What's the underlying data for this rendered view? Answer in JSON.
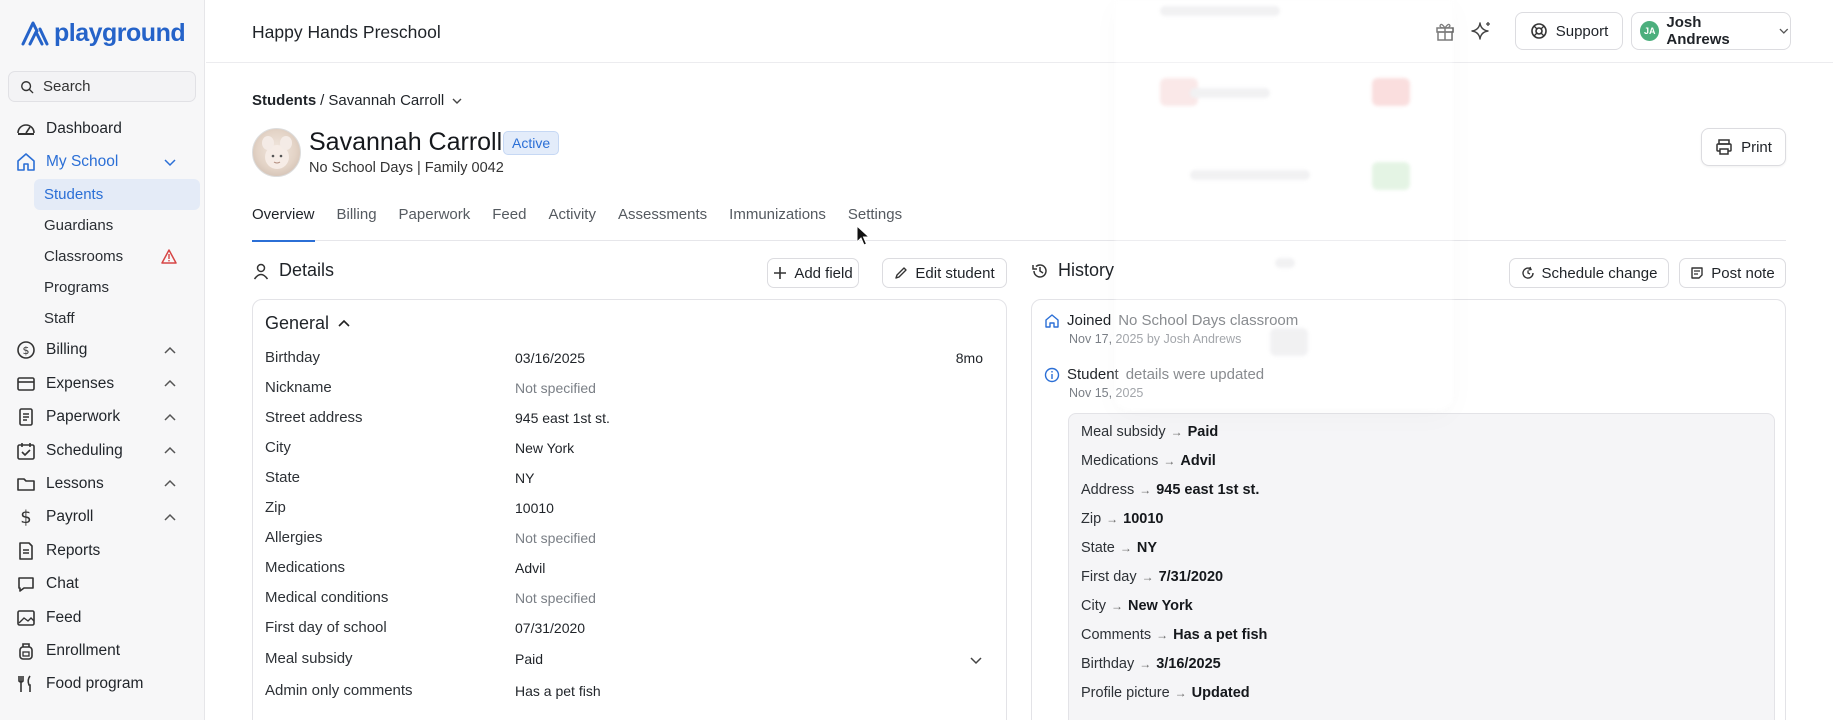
{
  "app": {
    "logo_text": "playground",
    "search_label": "Search"
  },
  "sidebar": {
    "items": [
      {
        "label": "Dashboard",
        "icon": "dashboard-icon"
      },
      {
        "label": "My School",
        "icon": "home-icon",
        "expanded": true
      },
      {
        "label": "Billing",
        "icon": "dollar-circle-icon"
      },
      {
        "label": "Expenses",
        "icon": "card-icon"
      },
      {
        "label": "Paperwork",
        "icon": "paperwork-icon"
      },
      {
        "label": "Scheduling",
        "icon": "calendar-check-icon"
      },
      {
        "label": "Lessons",
        "icon": "folder-icon"
      },
      {
        "label": "Payroll",
        "icon": "dollar-icon"
      },
      {
        "label": "Reports",
        "icon": "report-icon"
      },
      {
        "label": "Chat",
        "icon": "chat-icon"
      },
      {
        "label": "Feed",
        "icon": "image-icon"
      },
      {
        "label": "Enrollment",
        "icon": "backpack-icon"
      },
      {
        "label": "Food program",
        "icon": "utensils-icon"
      }
    ],
    "my_school_sub": [
      {
        "label": "Students",
        "selected": true
      },
      {
        "label": "Guardians"
      },
      {
        "label": "Classrooms",
        "warning": true
      },
      {
        "label": "Programs"
      },
      {
        "label": "Staff"
      }
    ]
  },
  "topbar": {
    "school_name": "Happy Hands Preschool",
    "support_label": "Support",
    "user_name": "Josh Andrews",
    "user_initials": "JA"
  },
  "breadcrumb": {
    "parent": "Students",
    "separator": "/",
    "current": "Savannah Carroll"
  },
  "student": {
    "name": "Savannah Carroll",
    "status": "Active",
    "subtitle": "No School Days | Family 0042"
  },
  "print_label": "Print",
  "tabs": [
    "Overview",
    "Billing",
    "Paperwork",
    "Feed",
    "Activity",
    "Assessments",
    "Immunizations",
    "Settings"
  ],
  "details": {
    "title": "Details",
    "add_field_label": "Add field",
    "edit_student_label": "Edit student",
    "general_title": "General",
    "fields": [
      {
        "label": "Birthday",
        "value": "03/16/2025",
        "extra": "8mo"
      },
      {
        "label": "Nickname",
        "value": "Not specified",
        "muted": true
      },
      {
        "label": "Street address",
        "value": "945 east 1st st."
      },
      {
        "label": "City",
        "value": "New York"
      },
      {
        "label": "State",
        "value": "NY"
      },
      {
        "label": "Zip",
        "value": "10010"
      },
      {
        "label": "Allergies",
        "value": "Not specified",
        "muted": true
      },
      {
        "label": "Medications",
        "value": "Advil"
      },
      {
        "label": "Medical conditions",
        "value": "Not specified",
        "muted": true
      },
      {
        "label": "First day of school",
        "value": "07/31/2020"
      },
      {
        "label": "Meal subsidy",
        "value": "Paid",
        "dropdown": true
      },
      {
        "label": "Admin only comments",
        "value": "Has a pet fish"
      }
    ]
  },
  "history": {
    "title": "History",
    "schedule_change_label": "Schedule change",
    "post_note_label": "Post note",
    "entries": [
      {
        "prefix": "Joined",
        "rest": "No School Days classroom",
        "meta": "Nov 17, 2025 by Josh Andrews"
      },
      {
        "prefix": "Student",
        "rest": "details were updated",
        "meta": "Nov 15, 2025"
      }
    ],
    "changes": [
      {
        "field": "Meal subsidy",
        "value": "Paid"
      },
      {
        "field": "Medications",
        "value": "Advil"
      },
      {
        "field": "Address",
        "value": "945 east 1st st."
      },
      {
        "field": "Zip",
        "value": "10010"
      },
      {
        "field": "State",
        "value": "NY"
      },
      {
        "field": "First day",
        "value": "7/31/2020"
      },
      {
        "field": "City",
        "value": "New York"
      },
      {
        "field": "Comments",
        "value": "Has a pet fish"
      },
      {
        "field": "Birthday",
        "value": "3/16/2025"
      },
      {
        "field": "Profile picture",
        "value": "Updated"
      }
    ]
  },
  "colors": {
    "accent": "#2b6fd6",
    "active_badge_bg": "#e3ecfa",
    "warning": "#d64545",
    "avatar_green": "#4caf7d"
  }
}
